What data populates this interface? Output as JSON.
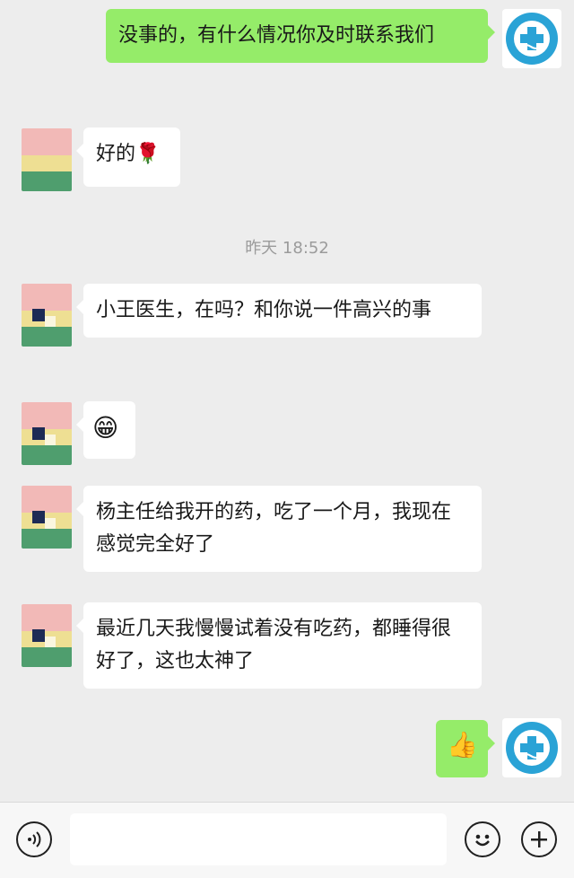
{
  "messages": [
    {
      "from": "me",
      "text": "没事的，有什么情况你及时联系我们"
    },
    {
      "from": "other",
      "text": "好的",
      "emoji": "🌹"
    },
    {
      "from": "other",
      "text": "小王医生，在吗？和你说一件高兴的事"
    },
    {
      "from": "other",
      "emoji": "😁"
    },
    {
      "from": "other",
      "text": "杨主任给我开的药，吃了一个月，我现在感觉完全好了"
    },
    {
      "from": "other",
      "text": "最近几天我慢慢试着没有吃药，都睡得很好了，这也太神了"
    },
    {
      "from": "me",
      "emoji": "👍"
    }
  ],
  "timestamp": "昨天 18:52",
  "input_bar": {
    "voice_icon": "voice-icon",
    "emoji_icon": "emoji-icon",
    "add_icon": "add-icon",
    "placeholder": ""
  },
  "colors": {
    "background": "#ededed",
    "bubble_me": "#95ec69",
    "bubble_other": "#ffffff",
    "logo_accent": "#2aa3d6"
  }
}
